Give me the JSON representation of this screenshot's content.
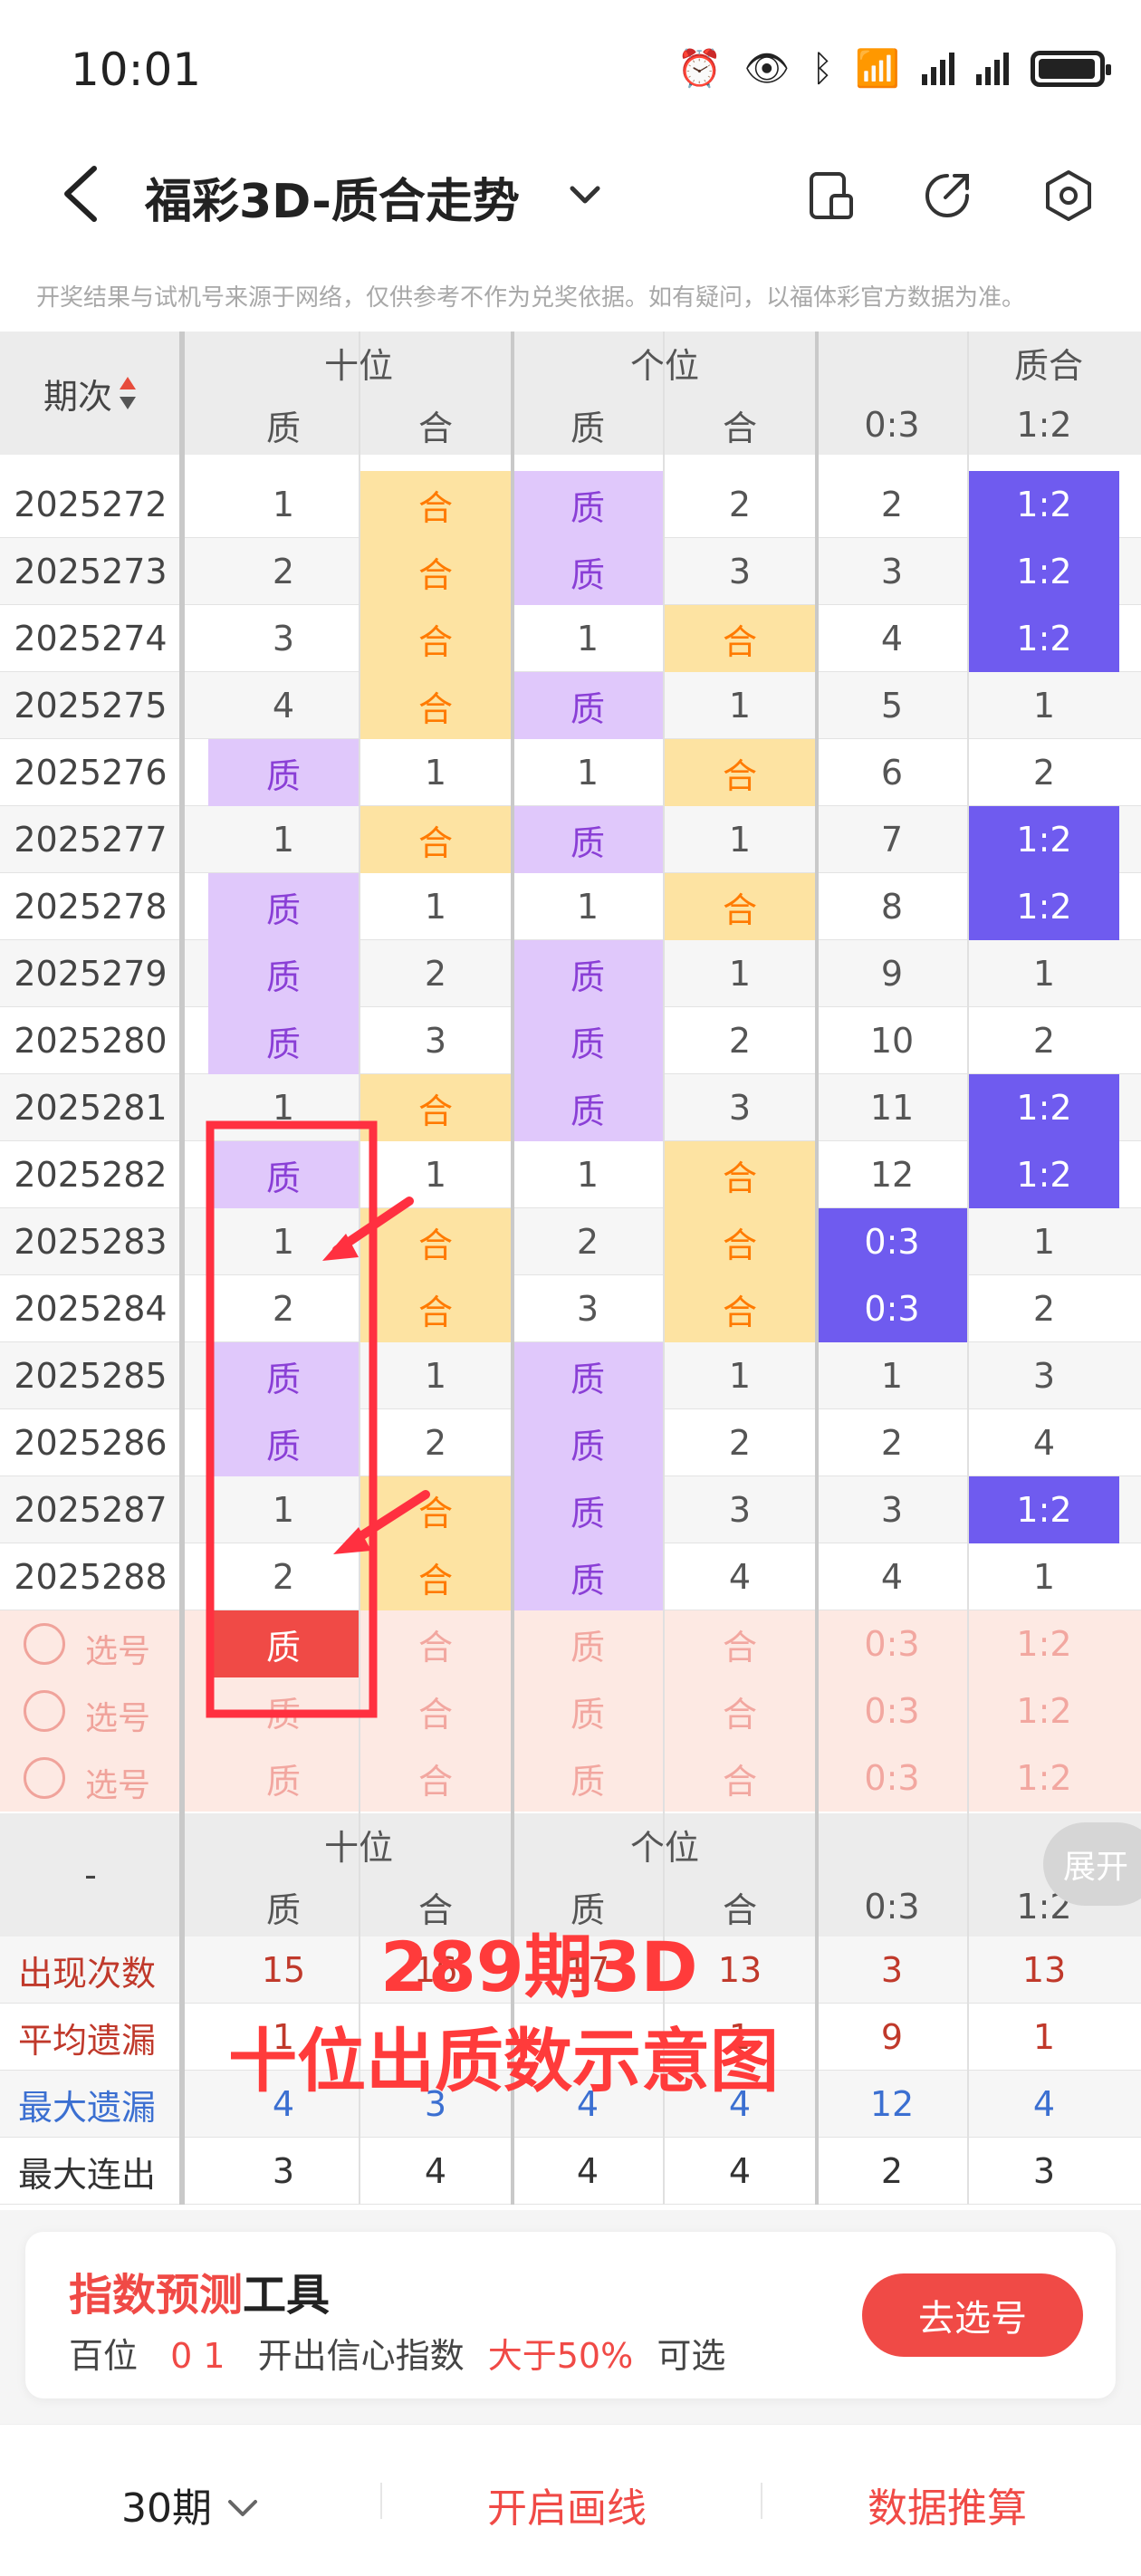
{
  "status_bar": {
    "time": "10:01"
  },
  "nav": {
    "title": "福彩3D-质合走势"
  },
  "disclaimer": "开奖结果与试机号来源于网络，仅供参考不作为兑奖依据。如有疑问，以福体彩官方数据为准。",
  "table": {
    "issue_header": "期次",
    "group_shiwei": "十位",
    "group_gewei": "个位",
    "group_zhihe": "质合",
    "sub_zhi": "质",
    "sub_he": "合",
    "sub_03": "0:3",
    "sub_12": "1:2",
    "rows": [
      {
        "issue": "2025272",
        "c": [
          "1",
          "合",
          "质",
          "2",
          "2",
          "1:2"
        ]
      },
      {
        "issue": "2025273",
        "c": [
          "2",
          "合",
          "质",
          "3",
          "3",
          "1:2"
        ]
      },
      {
        "issue": "2025274",
        "c": [
          "3",
          "合",
          "1",
          "合",
          "4",
          "1:2"
        ]
      },
      {
        "issue": "2025275",
        "c": [
          "4",
          "合",
          "质",
          "1",
          "5",
          "1"
        ]
      },
      {
        "issue": "2025276",
        "c": [
          "质",
          "1",
          "1",
          "合",
          "6",
          "2"
        ]
      },
      {
        "issue": "2025277",
        "c": [
          "1",
          "合",
          "质",
          "1",
          "7",
          "1:2"
        ]
      },
      {
        "issue": "2025278",
        "c": [
          "质",
          "1",
          "1",
          "合",
          "8",
          "1:2"
        ]
      },
      {
        "issue": "2025279",
        "c": [
          "质",
          "2",
          "质",
          "1",
          "9",
          "1"
        ]
      },
      {
        "issue": "2025280",
        "c": [
          "质",
          "3",
          "质",
          "2",
          "10",
          "2"
        ]
      },
      {
        "issue": "2025281",
        "c": [
          "1",
          "合",
          "质",
          "3",
          "11",
          "1:2"
        ]
      },
      {
        "issue": "2025282",
        "c": [
          "质",
          "1",
          "1",
          "合",
          "12",
          "1:2"
        ]
      },
      {
        "issue": "2025283",
        "c": [
          "1",
          "合",
          "2",
          "合",
          "0:3",
          "1"
        ]
      },
      {
        "issue": "2025284",
        "c": [
          "2",
          "合",
          "3",
          "合",
          "0:3",
          "2"
        ]
      },
      {
        "issue": "2025285",
        "c": [
          "质",
          "1",
          "质",
          "1",
          "1",
          "3"
        ]
      },
      {
        "issue": "2025286",
        "c": [
          "质",
          "2",
          "质",
          "2",
          "2",
          "4"
        ]
      },
      {
        "issue": "2025287",
        "c": [
          "1",
          "合",
          "质",
          "3",
          "3",
          "1:2"
        ]
      },
      {
        "issue": "2025288",
        "c": [
          "2",
          "合",
          "质",
          "4",
          "4",
          "1"
        ]
      }
    ],
    "pick_label": "选号",
    "picks": [
      [
        "质",
        "合",
        "质",
        "合",
        "0:3",
        "1:2"
      ],
      [
        "质",
        "合",
        "质",
        "合",
        "0:3",
        "1:2"
      ],
      [
        "质",
        "合",
        "质",
        "合",
        "0:3",
        "1:2"
      ]
    ],
    "footer_dash": "-",
    "expand_label": "展开",
    "stats": [
      {
        "label": "出现次数",
        "color": "#c0392b",
        "vals": [
          "15",
          "16",
          "17",
          "13",
          "3",
          "13"
        ]
      },
      {
        "label": "平均遗漏",
        "color": "#c0392b",
        "vals": [
          "1",
          "",
          "",
          "1",
          "9",
          "1"
        ]
      },
      {
        "label": "最大遗漏",
        "color": "#3b6fd1",
        "vals": [
          "4",
          "3",
          "4",
          "4",
          "12",
          "4"
        ]
      },
      {
        "label": "最大连出",
        "color": "#333333",
        "vals": [
          "3",
          "4",
          "4",
          "4",
          "2",
          "3"
        ]
      }
    ]
  },
  "overlay": {
    "line1": "289期3D",
    "line2": "十位出质数示意图",
    "color": "#ff3b3b"
  },
  "tool": {
    "title_red": "指数预测",
    "title_dark": "工具",
    "sub_pos": "百位",
    "sub_nums": "0 1",
    "sub_text": "开出信心指数",
    "sub_value": "大于50%",
    "sub_tail": "可选",
    "button": "去选号"
  },
  "bottom": {
    "period": "30期",
    "draw_line": "开启画线",
    "calc": "数据推算"
  },
  "colors": {
    "purple_bg": "#e0c8fb",
    "orange_bg": "#fde3a2",
    "blue_bg": "#6f5bef",
    "accent_red": "#f04a46"
  }
}
